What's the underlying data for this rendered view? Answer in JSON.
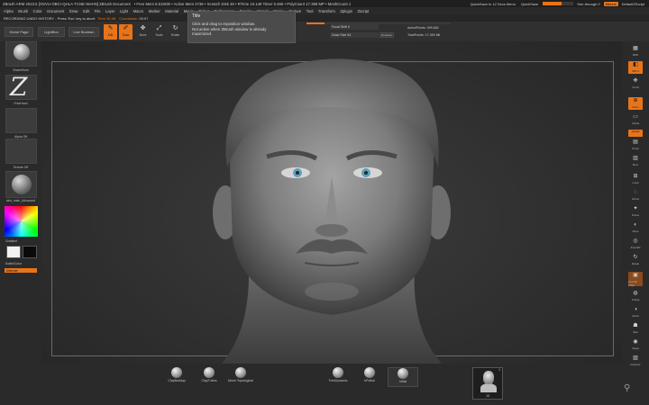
{
  "app": {
    "title": "ZBrush ARM 2023.5  [OSVU-OBCI-QHLA-TCNE-NHHN]   ZBrush Document",
    "stats": "• Free Mem 8.518GB • Active Mem 2736 • Scratch Disk 49 • RTime 10.149 Timer 0.465 • PolyCount 17.359 MP • MeshCount 1",
    "quicksave": "QuickSave in 12 Secs  Menu",
    "quicksave_btn": "QuickSave",
    "see_through": "See-through 0",
    "menus_btn": "Menus",
    "default_script": "DefaultZScript"
  },
  "menubar": [
    "Alpha",
    "Brush",
    "Color",
    "Document",
    "Draw",
    "Edit",
    "File",
    "Layer",
    "Light",
    "Macro",
    "Marker",
    "Material",
    "Movie",
    "Picker",
    "Preferences",
    "Render",
    "Stencil",
    "Stroke",
    "Texture",
    "Tool",
    "Transform",
    "Zplugin",
    "Zscript"
  ],
  "undo": {
    "label": "RECORDING UNDO HISTORY - Press 'Esc' key to abort.",
    "time": "Time 00:48",
    "countdown_label": "Countdown",
    "countdown": "00:07"
  },
  "toolbar": {
    "home_page": "Home Page",
    "lightbox": "LightBox",
    "live_boolean": "Live Boolean",
    "edit": "Edit",
    "draw": "Draw",
    "move": "Move",
    "scale": "Scale",
    "rotate": "Rotate",
    "focal_shift": "Focal Shift 0",
    "draw_size": "Draw Size 64",
    "dynamic": "Dynamic",
    "active_points": "ActivePoints: 999,882",
    "total_points": "TotalPoints: 17.359 Mil"
  },
  "tooltip": {
    "title": "Title",
    "line1": "Click and drag to reposition window.",
    "line2": "Not active when ZBrush window is already",
    "line3": "maximized."
  },
  "leftshelf": {
    "brush": "SnakeHook",
    "stroke": "FreeHand",
    "alpha": "Alpha Off",
    "texture": "Texture Off",
    "material": "skin_male_Advanced",
    "gradient": "Gradient",
    "switch_color": "SwitchColor",
    "alternate": "Alternate"
  },
  "rightshelf": [
    {
      "glyph": "▦",
      "label": "BPR"
    },
    {
      "glyph": "◧",
      "label": "SPix 3"
    },
    {
      "glyph": "✥",
      "label": "Scroll"
    },
    {
      "glyph": "⊕",
      "label": "Zoom"
    },
    {
      "glyph": "▭",
      "label": "Actual"
    },
    {
      "glyph": "◫",
      "label": "AAHalf"
    },
    {
      "glyph": "▤",
      "label": "Persp"
    },
    {
      "glyph": "▥",
      "label": "Floor"
    },
    {
      "glyph": "⊞",
      "label": "Local"
    },
    {
      "glyph": "◌",
      "label": "Gizmo"
    },
    {
      "glyph": "✦",
      "label": "Frame"
    },
    {
      "glyph": "◐",
      "label": "Move"
    },
    {
      "glyph": "◎",
      "label": "Zoom3D"
    },
    {
      "glyph": "↻",
      "label": "Rotate"
    },
    {
      "glyph": "▣",
      "label": "Line Fill PolyF"
    },
    {
      "glyph": "◍",
      "label": "Transp"
    },
    {
      "glyph": "◑",
      "label": "Ghost"
    },
    {
      "glyph": "☗",
      "label": "Solo"
    },
    {
      "glyph": "◉",
      "label": "Xpose"
    },
    {
      "glyph": "▧",
      "label": "Dynamic"
    }
  ],
  "bottomshelf": {
    "items": [
      {
        "label": "ClayBuildup"
      },
      {
        "label": "ClayTubes"
      },
      {
        "label": "Move Topological"
      },
      {
        "label": "TrimDynamic"
      },
      {
        "label": "hPolish"
      },
      {
        "label": "Inflat"
      }
    ],
    "thumb_label": "13",
    "thumb_num": "1"
  }
}
